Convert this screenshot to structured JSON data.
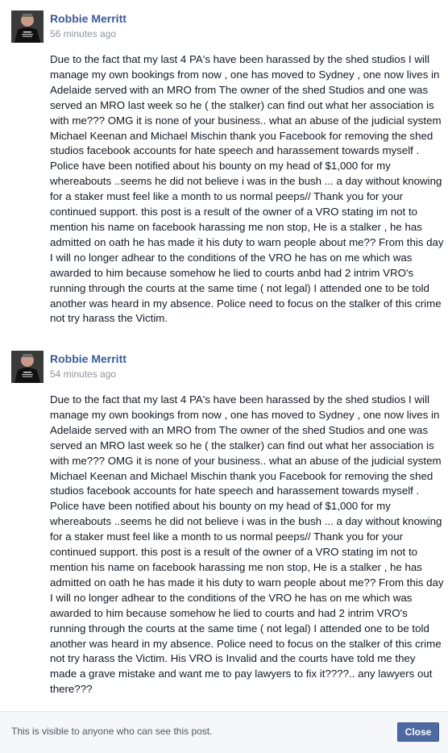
{
  "posts": [
    {
      "author": "Robbie Merritt",
      "time": "56 minutes ago",
      "text": "Due to the fact that my last 4 PA's have been harassed by the shed studios I will manage my own bookings from now , one has moved to Sydney , one now lives in Adelaide served with an MRO from The owner of the shed Studios and one was served an MRO last week so he ( the stalker) can find out what her association is with me??? OMG it is none of your business.. what an abuse of the judicial system Michael Keenan and Michael Mischin thank you Facebook for removing the shed studios facebook accounts for hate speech and harassement towards myself . Police have been notified about his bounty on my head of $1,000 for my whereabouts ..seems he did not believe i was in the bush ... a day without knowing for a staker must feel like a month to us normal peeps// Thank you for your continued support. this post is a result of the owner of a VRO stating im not to mention his name on facebook harassing me non stop, He is a stalker , he has admitted on oath he has made it his duty to warn people about me?? From this day I will no longer adhear to the conditions of the VRO he has on me which was awarded to him because somehow he lied to courts anbd had 2 intrim VRO's running through the courts at the same time ( not legal) I attended one to be told another was heard in my absence. Police need to focus on the stalker of this crime not try harass the Victim."
    },
    {
      "author": "Robbie Merritt",
      "time": "54 minutes ago",
      "text": "Due to the fact that my last 4 PA's have been harassed by the shed studios I will manage my own bookings from now , one has moved to Sydney , one now lives in Adelaide served with an MRO from The owner of the shed Studios and one was served an MRO last week so he ( the stalker) can find out what her association is with me??? OMG it is none of your business.. what an abuse of the judicial system Michael Keenan and Michael Mischin thank you Facebook for removing the shed studios facebook accounts for hate speech and harassement towards myself . Police have been notified about his bounty on my head of $1,000 for my whereabouts ..seems he did not believe i was in the bush ... a day without knowing for a staker must feel like a month to us normal peeps// Thank you for your continued support. this post is a result of the owner of a VRO stating im not to mention his name on facebook harassing me non stop, He is a stalker , he has admitted on oath he has made it his duty to warn people about me?? From this day I will no longer adhear to the conditions of the VRO he has on me which was awarded to him because somehow he lied to courts and had 2 intrim VRO's running through the courts at the same time ( not legal) I attended one to be told another was heard in my absence. Police need to focus on the stalker of this crime not try harass the Victim. His VRO is Invalid and the courts have told me they made a grave mistake and want me to pay lawyers to fix it????.. any lawyers out there???"
    }
  ],
  "footer": {
    "visibility_note": "This is visible to anyone who can see this post.",
    "close_label": "Close"
  },
  "colors": {
    "author_link": "#3b5998",
    "timestamp": "#90949c",
    "body_text": "#141823",
    "button_bg": "#4e69a2",
    "footer_bg": "#f6f7f9"
  }
}
